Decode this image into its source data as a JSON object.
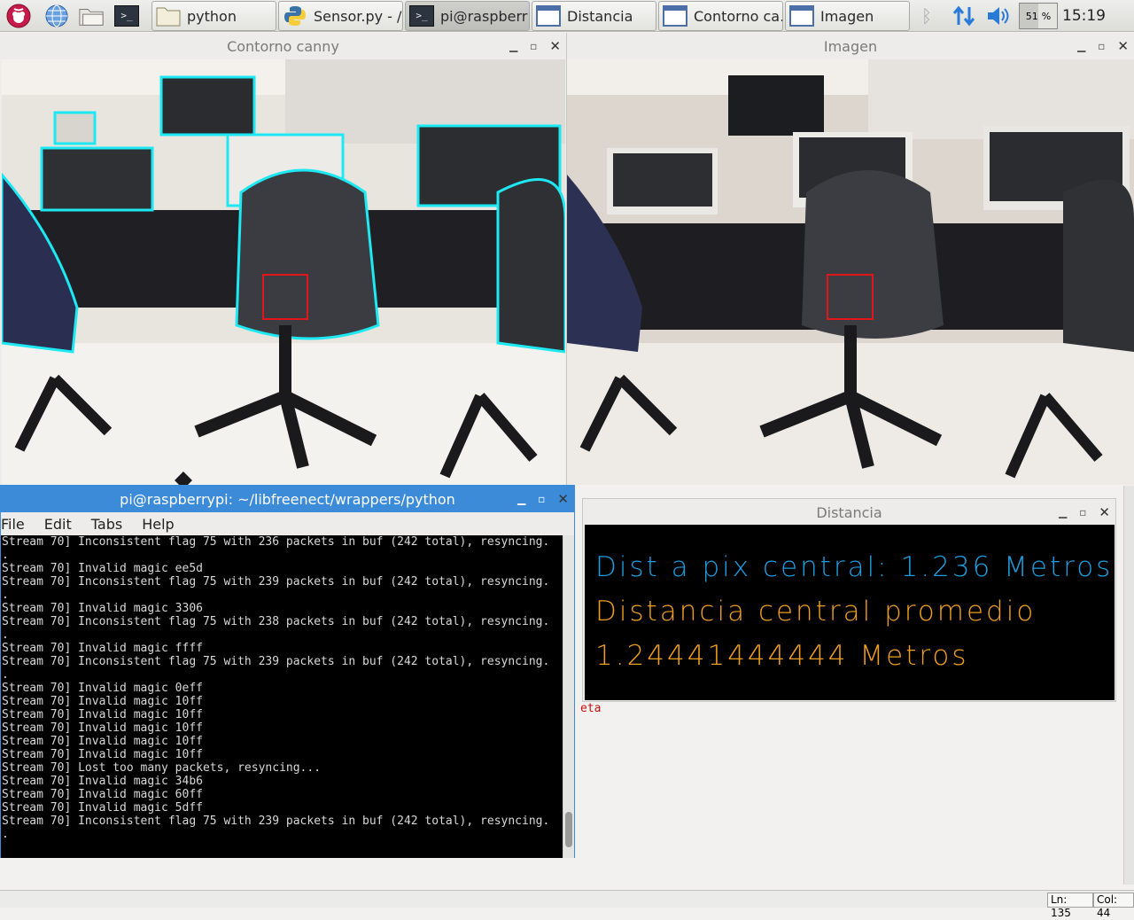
{
  "taskbar": {
    "launchers": [
      "raspberry-menu-icon",
      "globe-icon",
      "file-manager-icon",
      "terminal-icon"
    ],
    "tasks": [
      {
        "label": "python",
        "icon": "folder-icon",
        "active": false
      },
      {
        "label": "Sensor.py - /…",
        "icon": "python-icon",
        "active": false
      },
      {
        "label": "pi@raspberr…",
        "icon": "terminal-icon",
        "active": true
      },
      {
        "label": "Distancia",
        "icon": "window-icon",
        "active": false
      },
      {
        "label": "Contorno ca…",
        "icon": "window-icon",
        "active": false
      },
      {
        "label": "Imagen",
        "icon": "window-icon",
        "active": false
      }
    ],
    "cpu": "51",
    "cpu_unit": "%",
    "clock": "15:19"
  },
  "windows": {
    "canny": {
      "title": "Contorno canny"
    },
    "image": {
      "title": "Imagen"
    },
    "terminal": {
      "title": "pi@raspberrypi: ~/libfreenect/wrappers/python",
      "menu": [
        "File",
        "Edit",
        "Tabs",
        "Help"
      ],
      "lines": [
        "Stream 70] Inconsistent flag 75 with 236 packets in buf (242 total), resyncing.",
        ".",
        "Stream 70] Invalid magic ee5d",
        "Stream 70] Inconsistent flag 75 with 239 packets in buf (242 total), resyncing.",
        ".",
        "Stream 70] Invalid magic 3306",
        "Stream 70] Inconsistent flag 75 with 238 packets in buf (242 total), resyncing.",
        ".",
        "Stream 70] Invalid magic ffff",
        "Stream 70] Inconsistent flag 75 with 239 packets in buf (242 total), resyncing.",
        ".",
        "Stream 70] Invalid magic 0eff",
        "Stream 70] Invalid magic 10ff",
        "Stream 70] Invalid magic 10ff",
        "Stream 70] Invalid magic 10ff",
        "Stream 70] Invalid magic 10ff",
        "Stream 70] Invalid magic 10ff",
        "Stream 70] Lost too many packets, resyncing...",
        "Stream 70] Invalid magic 34b6",
        "Stream 70] Invalid magic 60ff",
        "Stream 70] Invalid magic 5dff",
        "Stream 70] Inconsistent flag 75 with 239 packets in buf (242 total), resyncing.",
        "."
      ]
    },
    "distancia": {
      "title": "Distancia",
      "line1": "Dist a pix central: 1.236 Metros",
      "line2": "Distancia central promedio",
      "line3": "1.24441444444 Metros",
      "color1": "#1e9ee0",
      "color2": "#f0a020"
    }
  },
  "editor_peek": {
    "text": "eta"
  },
  "statusbar": {
    "ln": "Ln: 135",
    "col": "Col: 44"
  }
}
